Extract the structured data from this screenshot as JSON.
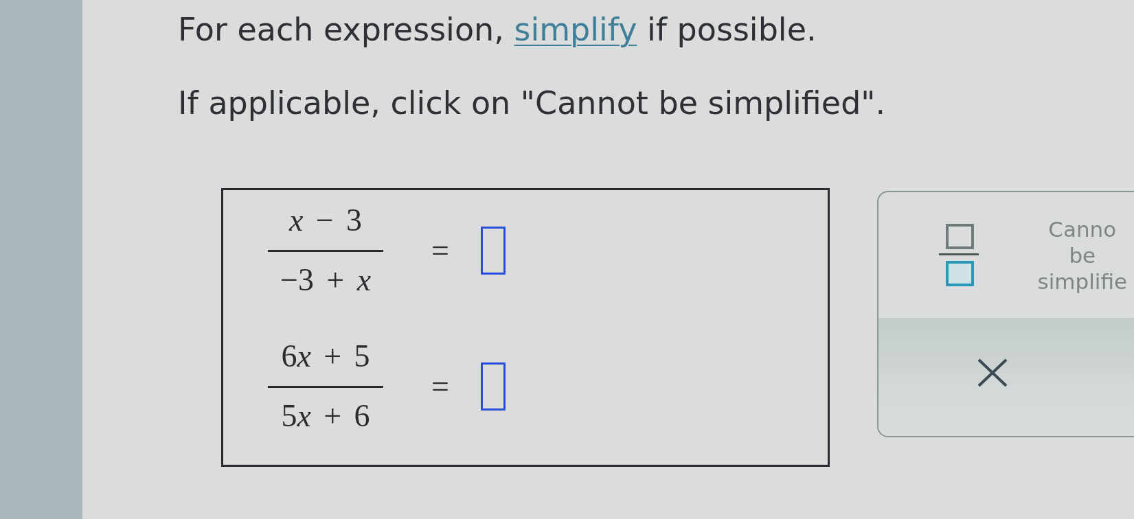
{
  "instructions": [
    {
      "parts": [
        {
          "kind": "text",
          "text": "For each expression, "
        },
        {
          "kind": "link",
          "text": "simplify"
        },
        {
          "kind": "text",
          "text": " if possible."
        }
      ]
    },
    {
      "parts": [
        {
          "kind": "text",
          "text": "If applicable, click on \"Cannot be simplified\"."
        }
      ]
    }
  ],
  "equations": [
    {
      "numerator": [
        {
          "text": "x",
          "italic": true
        },
        {
          "text": " − 3",
          "italic": false
        }
      ],
      "denominator": [
        {
          "text": "−3 + ",
          "italic": false
        },
        {
          "text": "x",
          "italic": true
        }
      ],
      "relation": "="
    },
    {
      "numerator": [
        {
          "text": "6",
          "italic": false
        },
        {
          "text": "x",
          "italic": true
        },
        {
          "text": " + 5",
          "italic": false
        }
      ],
      "denominator": [
        {
          "text": "5",
          "italic": false
        },
        {
          "text": "x",
          "italic": true
        },
        {
          "text": " + 6",
          "italic": false
        }
      ],
      "relation": "="
    }
  ],
  "answer_panel": {
    "buttons": [
      {
        "kind": "fraction"
      },
      {
        "kind": "cannot_simplify",
        "label": "Canno be simplifie"
      }
    ],
    "toolbar": [
      {
        "kind": "clear"
      }
    ]
  }
}
